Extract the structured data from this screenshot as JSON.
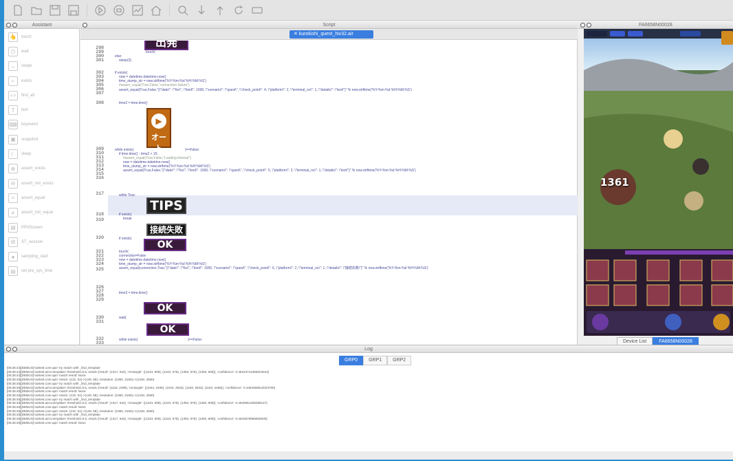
{
  "toolbar": {
    "icons": [
      "new-file-icon",
      "open-folder-icon",
      "save-icon",
      "save-as-icon",
      "run-icon",
      "stop-icon",
      "report-icon",
      "home-icon",
      "search-icon",
      "step-icon",
      "up-icon",
      "refresh-icon",
      "screen-icon"
    ]
  },
  "assistant": {
    "title": "Assistant",
    "items": [
      "touch",
      "wait",
      "swipe",
      "exists",
      "find_all",
      "text",
      "keyevent",
      "snapshot",
      "sleep",
      "assert_exists",
      "assert_not_exists",
      "assert_equal",
      "assert_not_equal",
      "PPrtScreen",
      "ST_session",
      "sampling_start",
      "set pre_sys_time"
    ]
  },
  "script": {
    "title": "Script",
    "tab": "kurokishi_quest_hiv32.air",
    "line_numbers": [
      "298",
      "299",
      "300",
      "301",
      "302",
      "303",
      "304",
      "305",
      "306",
      "307",
      "308",
      "309",
      "310",
      "311",
      "312",
      "313",
      "314",
      "315",
      "316",
      "317",
      "318",
      "319",
      "320",
      "321",
      "322",
      "323",
      "324",
      "325",
      "326",
      "327",
      "328",
      "329",
      "330",
      "331",
      "332",
      "333"
    ],
    "code": [
      "touch(",
      "else:",
      "sleep(3)",
      "if exists(",
      "now = datetime.datetime.now()",
      "time_stump_str = now.strftime('%Y-%m-%d %H:%M:%S')",
      "#assert_equal(True,False,\"connection failure\")",
      "assert_equal(True,False,\"{\\\"date\\\": \\\"%s\\\", \\\"kind\\\": 1000, \\\"scenario\\\": \\\"quest\\\", \\\"check_point\\\": 4, \\\"platform\\\": 2, \\\"terminal_no\\\": 1, \\\"details\\\": \\\"test\\\"}\" % now.strftime('%Y-%m-%d %H:%M:%S')",
      "time2 = time.time()",
      "while exists(",
      ")==False:",
      "if time.time() - time2 > 15:",
      "#assert_equal(True,False,\"Loading timeout\")",
      "now = datetime.datetime.now()",
      "time_stump_str = now.strftime('%Y-%m-%d %H:%M:%S')",
      "assert_equal(True,False,\"{\\\"date\\\": \\\"%s\\\", \\\"kind\\\": 1000, \\\"scenario\\\": \\\"quest\\\", \\\"check_point\\\": 5, \\\"platform\\\": 2, \\\"terminal_no\\\": 1, \\\"details\\\": \\\"test\\\"}\" % now.strftime('%Y-%m-%d %H:%M:%S')",
      "while True:",
      "if exists(",
      "break",
      "if exists(",
      "touch(",
      "connection=False",
      "now = datetime.datetime.now()",
      "time_stump_str = now.strftime('%Y-%m-%d %H:%M:%S')",
      "assert_equal(connection,True,\"{\\\"date\\\": \\\"%s\\\", \\\"kind\\\": 1000, \\\"scenario\\\": \\\"quest\\\", \\\"check_point\\\": 6, \\\"platform\\\": 2, \\\"terminal_no\\\": 1, \\\"details\\\": \\\"接続失敗\\\"}\" % now.strftime('%Y-%m-%d %H:%M:%S')",
      "time3 = time.time()",
      "wait(",
      "while exists(",
      ")==False:"
    ],
    "buttons": {
      "top": "出発",
      "tips": "TIPS",
      "fail": "接続失敗",
      "ok": "OK",
      "ok2": "OK",
      "ok3": "OK",
      "loading": "オート"
    }
  },
  "device": {
    "title": "FA6658N00028",
    "tab_list": "Device List",
    "tab_device": "FA6658N00028",
    "damage": "1361"
  },
  "log": {
    "title": "Log",
    "tabs": [
      "GRP0",
      "GRP1",
      "GRP2"
    ],
    "lines": [
      "[05:35:44][DEBUG]<airtest.core.api> try match with _find_template",
      "[05:35:44][DEBUG]<airtest.aircv.template> threshold=0.5, result={'result': (1317, 642), 'rectangle': ((1243, 608), (1243, 676), (1392, 676), (1392, 608)), 'confidence': 0.46243712306022644}",
      "[05:35:44][DEBUG]<airtest.core.api> match result: None",
      "[05:35:45][DEBUG]<airtest.core.api> resize: (132, 51)->(149, 58), resolution: (1080, 2160)=>(1440, 2560)",
      "[05:35:45][DEBUG]<airtest.core.api> try match with _find_template",
      "[05:35:45][DEBUG]<airtest.aircv.template> threshold=0.5, result={'result': (1118, 2499), 'rectangle': ((1044, 2465), (1044, 2533), (1193, 2533), (1193, 2465)), 'confidence': 0.4494358513023705}",
      "[05:35:45][DEBUG]<airtest.core.api> match result: None",
      "[05:35:45][DEBUG]<airtest.core.api> resize: (132, 51)->(149, 58), resolution: (1080, 2160)=>(1440, 2560)",
      "[05:35:45][DEBUG]<airtest.core.api> try match with _find_template",
      "[05:35:46][DEBUG]<airtest.aircv.template> threshold=0.5, result={'result': (1317, 642), 'rectangle': ((1243, 608), (1243, 676), (1392, 676), (1392, 608)), 'confidence': 0.4626651406288147}",
      "[05:35:46][DEBUG]<airtest.core.api> match result: None",
      "[05:35:46][DEBUG]<airtest.core.api> resize: (132, 51)->(149, 58), resolution: (1080, 2160)=>(1440, 2560)",
      "[05:35:46][DEBUG]<airtest.core.api> try match with _find_template",
      "[05:35:46][DEBUG]<airtest.aircv.template> threshold=0.5, result={'result': (1317, 642), 'rectangle': ((1243, 608), (1243, 676), (1392, 676), (1392, 608)), 'confidence': 0.4623678956508636}",
      "[05:35:46][DEBUG]<airtest.core.api> match result: None"
    ]
  }
}
